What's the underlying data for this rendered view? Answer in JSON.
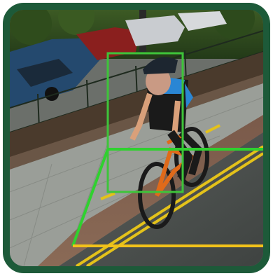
{
  "image": {
    "subject": "cctv-cyclist-detection",
    "colors": {
      "frame": "#1d5a39",
      "detection_box": "#3ec43a",
      "zone_overlay": "#2fd12f",
      "road_line": "#e4c21a",
      "stop_line": "#f2c21a"
    }
  }
}
